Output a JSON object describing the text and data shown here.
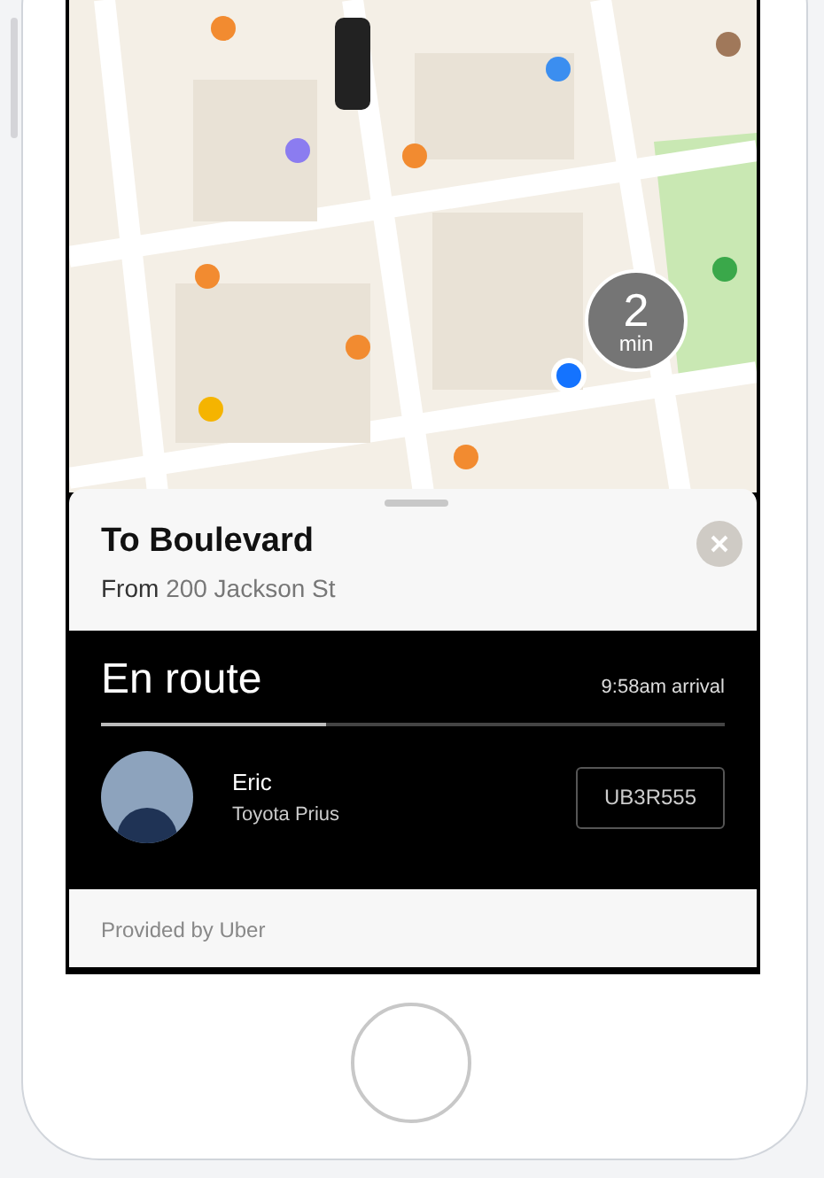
{
  "map": {
    "eta": {
      "value": "2",
      "unit": "min"
    }
  },
  "sheet": {
    "title": "To Boulevard",
    "from_label": "From",
    "from_address": "200 Jackson St"
  },
  "trip": {
    "status": "En route",
    "arrival": "9:58am arrival",
    "progress": {
      "level": 0.36
    },
    "driver": {
      "name": "Eric",
      "car": "Toyota Prius",
      "plate": "UB3R555"
    }
  },
  "footer": "Provided by Uber"
}
